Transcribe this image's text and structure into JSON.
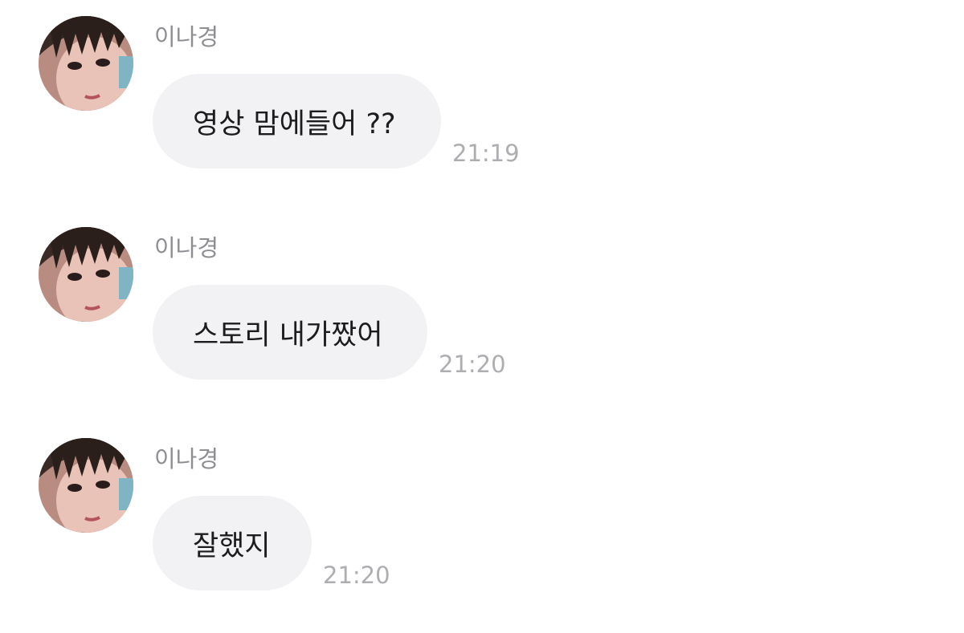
{
  "messages": [
    {
      "sender": "이나경",
      "text": "영상 맘에들어 ??",
      "time": "21:19"
    },
    {
      "sender": "이나경",
      "text": "스토리 내가짰어",
      "time": "21:20"
    },
    {
      "sender": "이나경",
      "text": "잘했지",
      "time": "21:20"
    }
  ],
  "colors": {
    "background": "#ffffff",
    "bubble": "#f2f2f5",
    "sender_text": "#8e8e93",
    "time_text": "#aeaeb2",
    "message_text": "#1c1c1e"
  },
  "icons": {
    "avatar": "avatar-photo"
  }
}
